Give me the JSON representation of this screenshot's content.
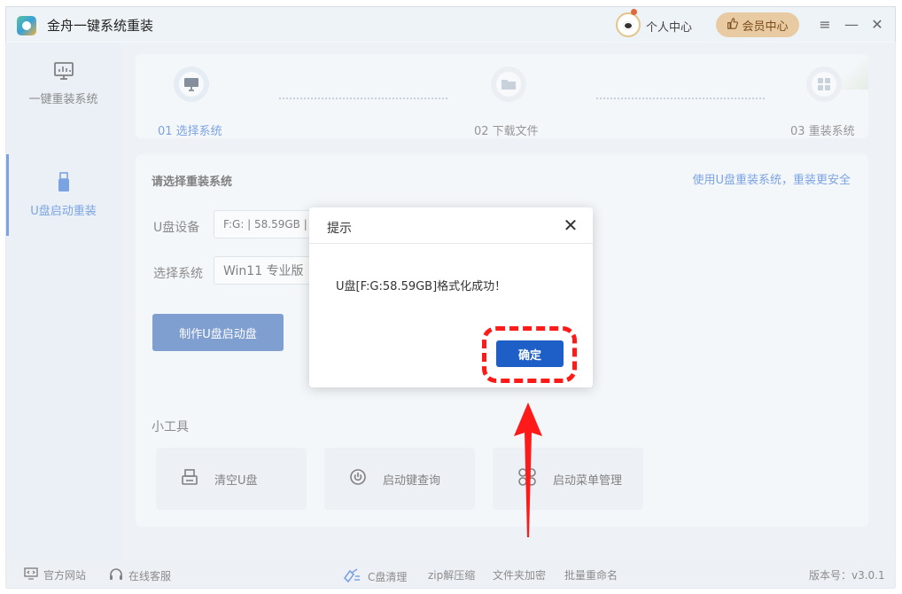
{
  "window": {
    "title": "金舟一键系统重装",
    "personal_center": "个人中心",
    "member_center": "会员中心",
    "menu_icon": "≡",
    "minimize_icon": "—",
    "close_icon": "✕"
  },
  "sidebar": {
    "items": [
      {
        "label": "一键重装系统",
        "icon": "monitor-icon",
        "active": false
      },
      {
        "label": "U盘启动重装",
        "icon": "usb-icon",
        "active": true
      }
    ]
  },
  "steps": [
    {
      "label": "01 选择系统",
      "active": true
    },
    {
      "label": "02 下载文件",
      "active": false
    },
    {
      "label": "03 重装系统",
      "active": false
    }
  ],
  "main": {
    "section_title": "请选择重装系统",
    "safe_link": "使用U盘重装系统，重装更安全",
    "usb_label": "U盘设备",
    "usb_value": "F:G: | 58.59GB |",
    "system_label": "选择系统",
    "system_value": "Win11 专业版",
    "make_button": "制作U盘启动盘",
    "tools_title": "小工具",
    "tools": [
      {
        "label": "清空U盘",
        "icon": "usb-clear-icon"
      },
      {
        "label": "启动键查询",
        "icon": "power-icon"
      },
      {
        "label": "启动菜单管理",
        "icon": "menu-manage-icon"
      }
    ]
  },
  "bottombar": {
    "website": "官方网站",
    "service": "在线客服",
    "c_clean": "C盘清理",
    "zip": "zip解压缩",
    "encrypt": "文件夹加密",
    "rename": "批量重命名",
    "version": "版本号：v3.0.1"
  },
  "dialog": {
    "title": "提示",
    "message": "U盘[F:G:58.59GB]格式化成功！",
    "ok_button": "确定",
    "close_icon": "✕"
  },
  "colors": {
    "accent": "#2a6bd1",
    "primary_button": "#3164b4",
    "ok_button": "#1d5fc7",
    "annotation": "#ff1a1a"
  }
}
